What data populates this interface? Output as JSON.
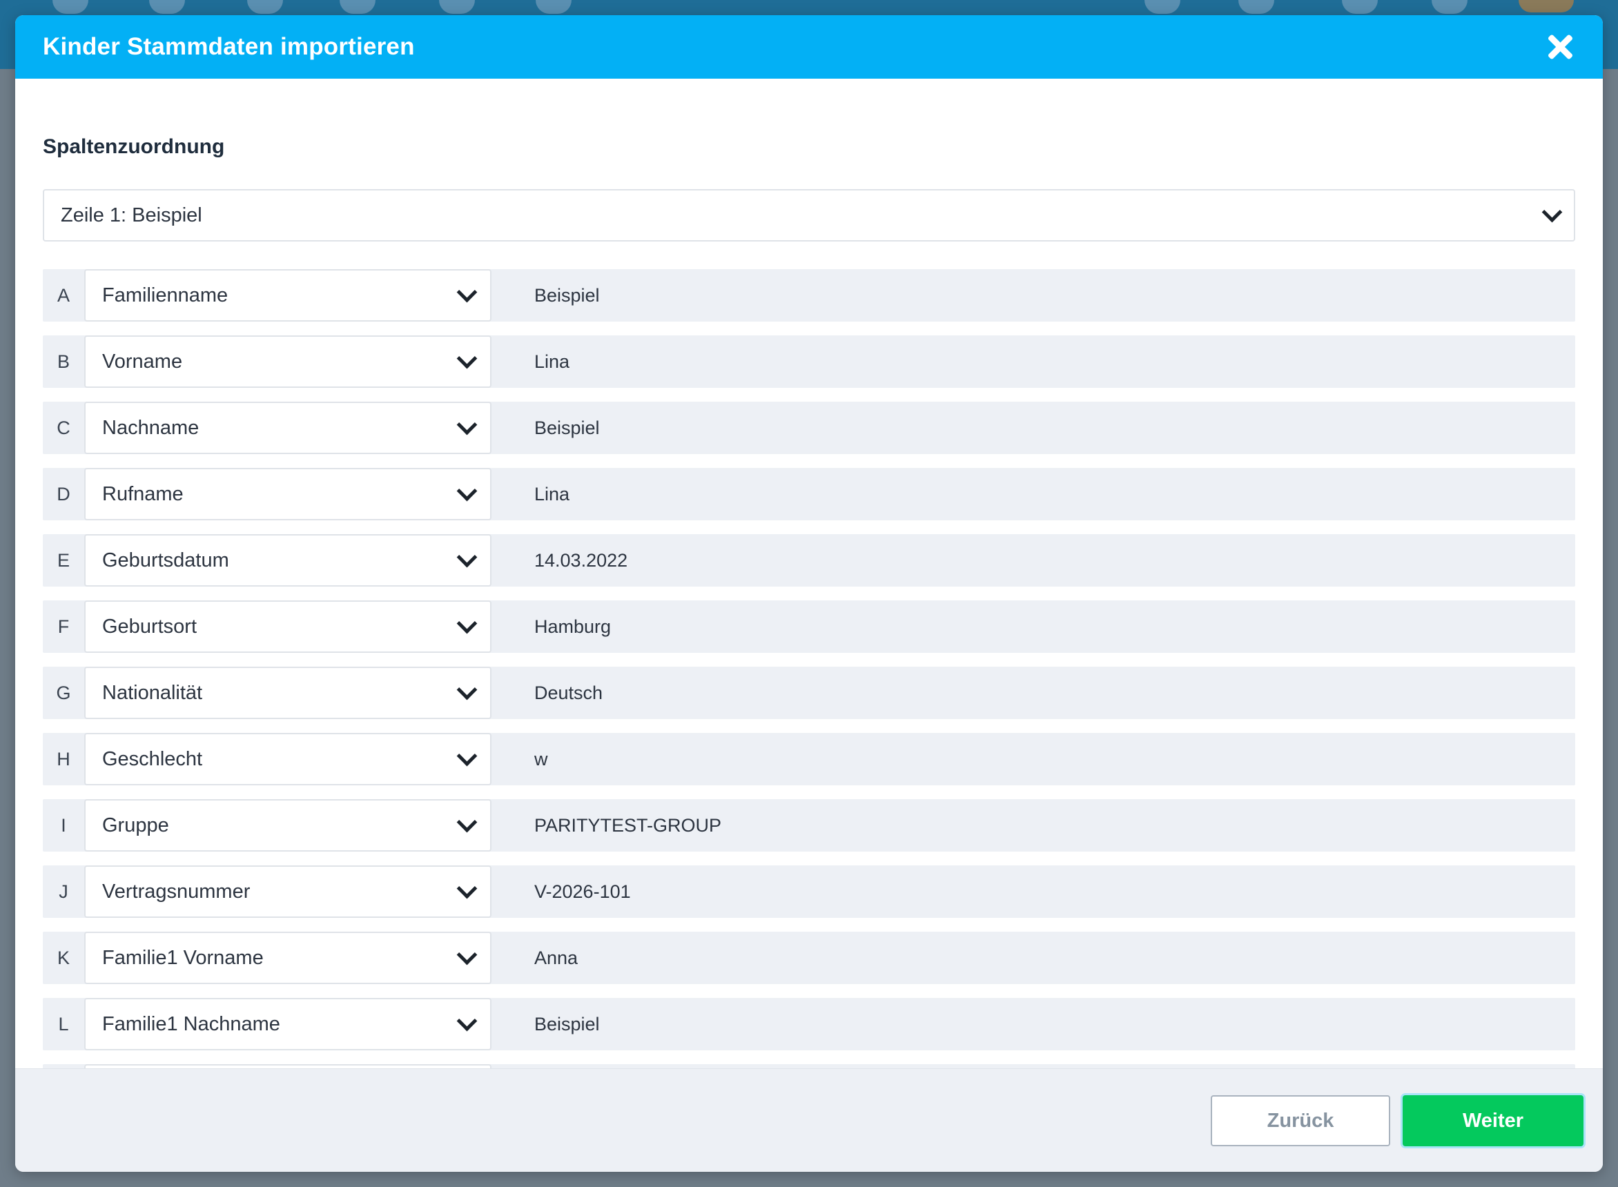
{
  "dialog": {
    "title": "Kinder Stammdaten importieren",
    "close_icon": "close-icon"
  },
  "section": {
    "title": "Spaltenzuordnung"
  },
  "row_selector": {
    "value": "Zeile 1: Beispiel"
  },
  "mappings": [
    {
      "letter": "A",
      "field": "Familienname",
      "sample": "Beispiel"
    },
    {
      "letter": "B",
      "field": "Vorname",
      "sample": "Lina"
    },
    {
      "letter": "C",
      "field": "Nachname",
      "sample": "Beispiel"
    },
    {
      "letter": "D",
      "field": "Rufname",
      "sample": "Lina"
    },
    {
      "letter": "E",
      "field": "Geburtsdatum",
      "sample": "14.03.2022"
    },
    {
      "letter": "F",
      "field": "Geburtsort",
      "sample": "Hamburg"
    },
    {
      "letter": "G",
      "field": "Nationalität",
      "sample": "Deutsch"
    },
    {
      "letter": "H",
      "field": "Geschlecht",
      "sample": "w"
    },
    {
      "letter": "I",
      "field": "Gruppe",
      "sample": "PARITYTEST-GROUP"
    },
    {
      "letter": "J",
      "field": "Vertragsnummer",
      "sample": "V-2026-101"
    },
    {
      "letter": "K",
      "field": "Familie1 Vorname",
      "sample": "Anna"
    },
    {
      "letter": "L",
      "field": "Familie1 Nachname",
      "sample": "Beispiel"
    }
  ],
  "footer": {
    "back_label": "Zurück",
    "next_label": "Weiter"
  },
  "colors": {
    "header": "#03b0f5",
    "primary_button": "#04c95d",
    "row_background": "#edf0f5"
  }
}
